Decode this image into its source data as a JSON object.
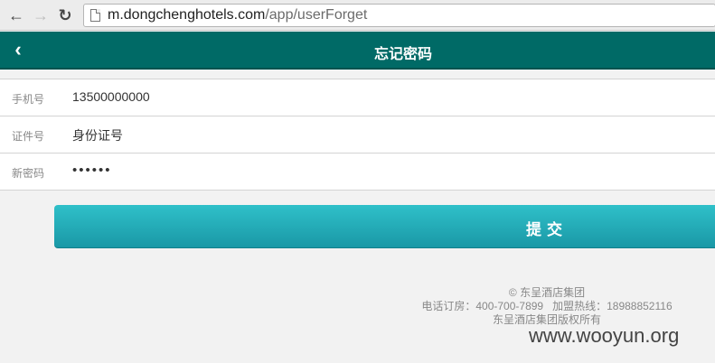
{
  "browser": {
    "back_icon": "←",
    "forward_icon": "→",
    "reload_icon": "↻",
    "url_host": "m.dongchenghotels.com",
    "url_path": "/app/userForget"
  },
  "header": {
    "back_icon": "‹",
    "title": "忘记密码",
    "color": "#006a66"
  },
  "form": {
    "rows": [
      {
        "label": "手机号",
        "value": "13500000000"
      },
      {
        "label": "证件号",
        "value": "身份证号"
      },
      {
        "label": "新密码",
        "value": "••••••"
      }
    ]
  },
  "submit": {
    "label": "提交",
    "color": "#1fa8b5"
  },
  "footer": {
    "copyright": "© 东呈酒店集团",
    "contact": "电话订房：400-700-7899   加盟热线：18988852116",
    "rights": "东呈酒店集团版权所有"
  },
  "watermark": "www.wooyun.org"
}
